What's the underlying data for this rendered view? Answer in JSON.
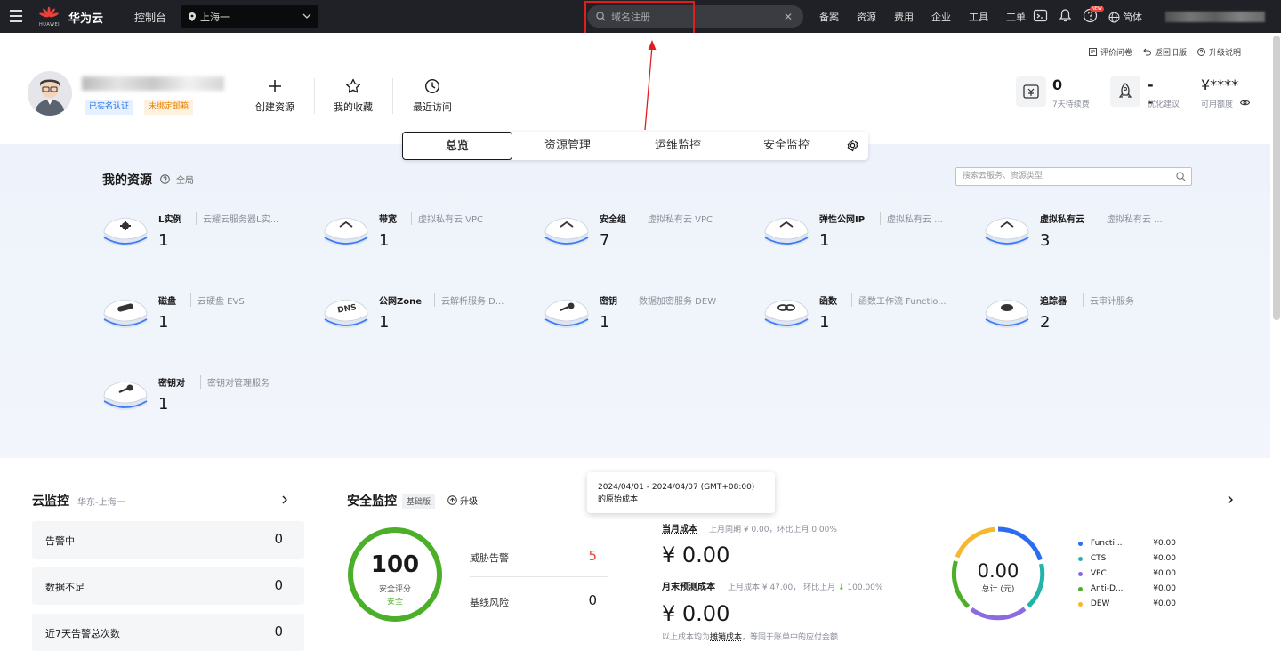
{
  "topbar": {
    "brand": "华为云",
    "logo_text": "HUAWEI",
    "console": "控制台",
    "region": "上海一",
    "search_placeholder": "域名注册",
    "links": [
      "备案",
      "资源",
      "费用",
      "企业",
      "工具",
      "工单"
    ],
    "new_badge": "NEW",
    "language": "简体"
  },
  "header": {
    "badges": [
      "已实名认证",
      "未绑定邮箱"
    ],
    "quick_actions": [
      {
        "label": "创建资源",
        "icon": "plus-icon"
      },
      {
        "label": "我的收藏",
        "icon": "star-icon"
      },
      {
        "label": "最近访问",
        "icon": "clock-icon"
      }
    ],
    "links": [
      "评价问卷",
      "返回旧版",
      "升级说明"
    ],
    "stats": [
      {
        "value": "0",
        "label": "7天待续费",
        "icon": "renew-icon"
      },
      {
        "value": "--",
        "label": "优化建议",
        "icon": "rocket-icon"
      },
      {
        "value": "¥****",
        "label": "可用额度",
        "icon": "eye-icon"
      }
    ]
  },
  "tabs": [
    "总览",
    "资源管理",
    "运维监控",
    "安全监控"
  ],
  "resources": {
    "title": "我的资源",
    "scope": "全局",
    "search_placeholder": "搜索云服务、资源类型",
    "items": [
      {
        "name": "L实例",
        "desc": "云耀云服务器L实...",
        "count": "1"
      },
      {
        "name": "带宽",
        "desc": "虚拟私有云 VPC",
        "count": "1"
      },
      {
        "name": "安全组",
        "desc": "虚拟私有云 VPC",
        "count": "7"
      },
      {
        "name": "弹性公网IP",
        "desc": "虚拟私有云 ...",
        "count": "1"
      },
      {
        "name": "虚拟私有云",
        "desc": "虚拟私有云 ...",
        "count": "3"
      },
      {
        "name": "磁盘",
        "desc": "云硬盘 EVS",
        "count": "1"
      },
      {
        "name": "公网Zone",
        "desc": "云解析服务 D...",
        "count": "1"
      },
      {
        "name": "密钥",
        "desc": "数据加密服务 DEW",
        "count": "1"
      },
      {
        "name": "函数",
        "desc": "函数工作流 Functio...",
        "count": "1"
      },
      {
        "name": "追踪器",
        "desc": "云审计服务",
        "count": "2"
      },
      {
        "name": "密钥对",
        "desc": "密钥对管理服务",
        "count": "1"
      }
    ]
  },
  "cloud_monitor": {
    "title": "云监控",
    "region": "华东-上海一",
    "rows": [
      {
        "label": "告警中",
        "value": "0"
      },
      {
        "label": "数据不足",
        "value": "0"
      },
      {
        "label": "近7天告警总次数",
        "value": "0"
      }
    ]
  },
  "security": {
    "title": "安全监控",
    "edition": "基础版",
    "upgrade": "升级",
    "score": "100",
    "score_label": "安全评分",
    "score_status": "安全",
    "rows": [
      {
        "label": "威胁告警",
        "value": "5"
      },
      {
        "label": "基线风险",
        "value": "0"
      }
    ]
  },
  "cost": {
    "tooltip": "2024/04/01 - 2024/04/07 (GMT+08:00) 的原始成本",
    "current_label": "当月成本",
    "current_sub": "上月同期 ¥ 0.00，环比上月 0.00%",
    "current_value": "¥ 0.00",
    "forecast_label": "月末预测成本",
    "forecast_sub_a": "上月成本 ¥ 47.00，",
    "forecast_sub_b": "环比上月",
    "forecast_sub_c": "100.00%",
    "forecast_value": "¥ 0.00",
    "footnote_a": "以上成本均为",
    "footnote_b": "摊销成本",
    "footnote_c": "，等同于账单中的应付金额",
    "donut_value": "0.00",
    "donut_label": "总计 (元)",
    "legend": [
      {
        "name": "Functi...",
        "value": "¥0.00",
        "color": "#2b6cf0"
      },
      {
        "name": "CTS",
        "value": "¥0.00",
        "color": "#23b3a8"
      },
      {
        "name": "VPC",
        "value": "¥0.00",
        "color": "#8a6ce0"
      },
      {
        "name": "Anti-D...",
        "value": "¥0.00",
        "color": "#4caf2a"
      },
      {
        "name": "DEW",
        "value": "¥0.00",
        "color": "#f5b82e"
      }
    ]
  }
}
